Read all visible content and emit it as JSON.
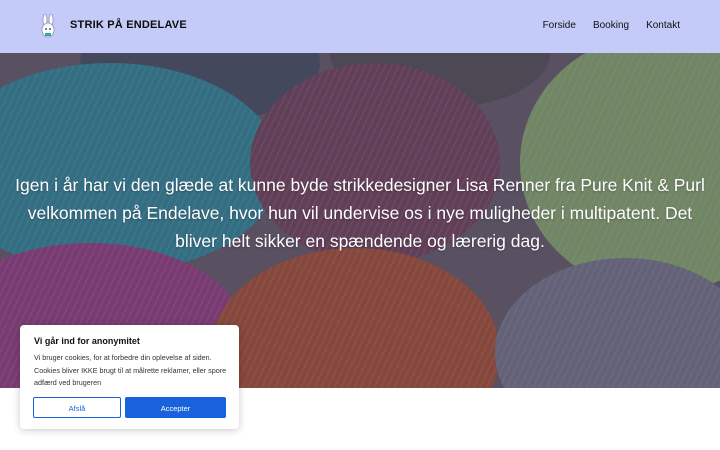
{
  "header": {
    "site_title": "STRIK PÅ ENDELAVE",
    "logo_icon": "bunny-logo-icon",
    "background_color": "#c4cbf9",
    "nav": [
      {
        "label": "Forside"
      },
      {
        "label": "Booking"
      },
      {
        "label": "Kontakt"
      }
    ]
  },
  "hero": {
    "text": "Igen i år har vi den glæde at kunne byde strikkedesigner Lisa Renner fra Pure Knit & Purl velkommen på Endelave, hvor hun vil undervise os i nye muligheder i multipatent. Det bliver helt sikker en spændende og lærerig dag.",
    "image": "yarn-balls-photo"
  },
  "cookie_banner": {
    "title": "Vi går ind for anonymitet",
    "body": "Vi bruger cookies, for at forbedre din oplevelse af siden. Cookies bliver IKKE brugt til at målrette reklamer, eller spore adfærd ved brugeren",
    "reject_label": "Afslå",
    "accept_label": "Accepter",
    "accent_color": "#1863dc"
  }
}
